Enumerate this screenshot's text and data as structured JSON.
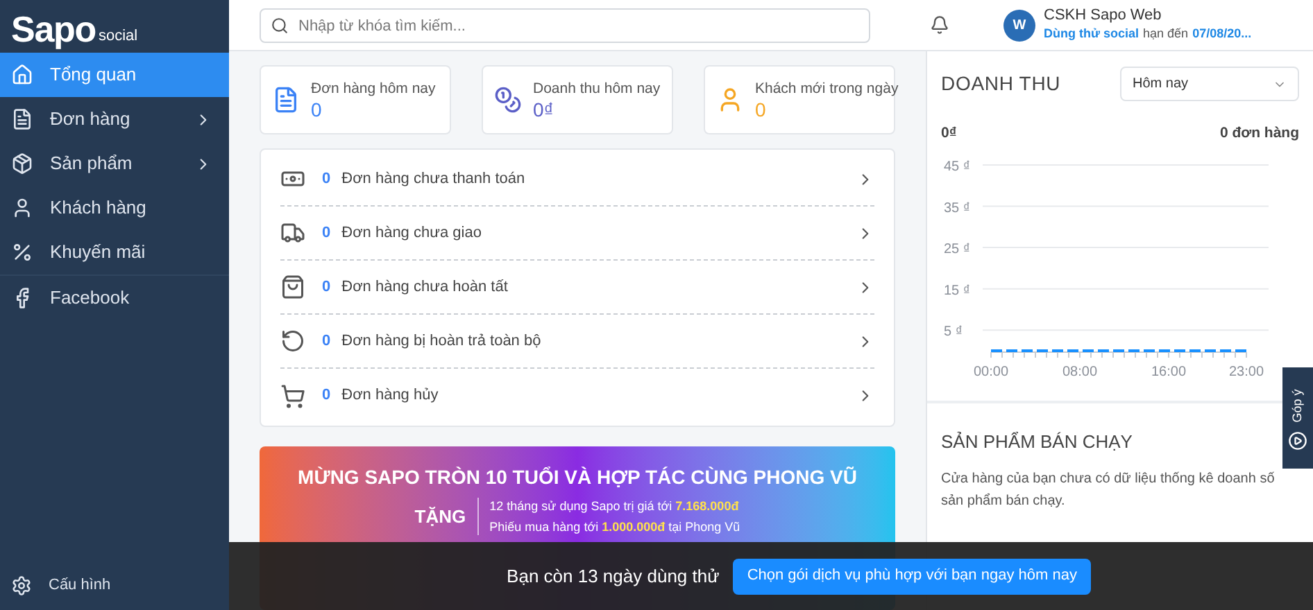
{
  "logo": {
    "name": "Sapo",
    "suffix": "social"
  },
  "sidebar": {
    "items": [
      {
        "label": "Tổng quan",
        "selected": true,
        "has_submenu": false
      },
      {
        "label": "Đơn hàng",
        "selected": false,
        "has_submenu": true
      },
      {
        "label": "Sản phẩm",
        "selected": false,
        "has_submenu": true
      },
      {
        "label": "Khách hàng",
        "selected": false,
        "has_submenu": false
      },
      {
        "label": "Khuyến mãi",
        "selected": false,
        "has_submenu": false
      },
      {
        "label": "Facebook",
        "selected": false,
        "has_submenu": false
      }
    ],
    "settings": "Cấu hình"
  },
  "header": {
    "search": {
      "placeholder": "Nhập từ khóa tìm kiếm..."
    },
    "user": {
      "avatar": "W",
      "name": "CSKH Sapo Web",
      "trial_label": "Dùng thử social",
      "trial_middle": "hạn đến",
      "trial_date": "07/08/20..."
    }
  },
  "stats": [
    {
      "label": "Đơn hàng hôm nay",
      "value": "0",
      "color": "#3b82f6"
    },
    {
      "label": "Doanh thu hôm nay",
      "value": "0₫",
      "color": "#5b5fc7"
    },
    {
      "label": "Khách mới trong ngày",
      "value": "0",
      "color": "#f5a623"
    }
  ],
  "orders": [
    {
      "count": "0",
      "label": "Đơn hàng chưa thanh toán"
    },
    {
      "count": "0",
      "label": "Đơn hàng chưa giao"
    },
    {
      "count": "0",
      "label": "Đơn hàng chưa hoàn tất"
    },
    {
      "count": "0",
      "label": "Đơn hàng bị hoàn trả toàn bộ"
    },
    {
      "count": "0",
      "label": "Đơn hàng hủy"
    }
  ],
  "banner": {
    "title": "MỪNG SAPO TRÒN 10 TUỔI VÀ HỢP TÁC CÙNG PHONG VŨ",
    "gift_label": "TẶNG",
    "lines": [
      "12 tháng sử dụng Sapo trị giá tới **7.168.000đ**",
      "Phiếu mua hàng tới **1.000.000đ** tại Phong Vũ"
    ]
  },
  "revenue": {
    "title": "DOANH THU",
    "period": "Hôm nay",
    "total": "0₫",
    "orders": "0 đơn hàng",
    "chart_data": {
      "type": "line",
      "x": [
        0,
        1,
        2,
        3,
        4,
        5,
        6,
        7,
        8,
        9,
        10,
        11,
        12,
        13,
        14,
        15,
        16,
        17,
        18,
        19,
        20,
        21,
        22,
        23
      ],
      "xlim": [
        0,
        23
      ],
      "ylim": [
        0,
        45
      ],
      "series": [
        {
          "color": "#1890ff",
          "line_style": "dashed",
          "values": [
            0,
            0,
            0,
            0,
            0,
            0,
            0,
            0,
            0,
            0,
            0,
            0,
            0,
            0,
            0,
            0,
            0,
            0,
            0,
            0,
            0,
            0,
            0,
            0
          ]
        }
      ],
      "grid": true,
      "xticks": [
        {
          "value": 0,
          "label": "00:00"
        },
        {
          "value": 8,
          "label": "08:00"
        },
        {
          "value": 16,
          "label": "16:00"
        },
        {
          "value": 23,
          "label": "23:00"
        }
      ],
      "yticks": [
        {
          "value": 5,
          "label": "5 ₫"
        },
        {
          "value": 15,
          "label": "15 ₫"
        },
        {
          "value": 25,
          "label": "25 ₫"
        },
        {
          "value": 35,
          "label": "35 ₫"
        },
        {
          "value": 45,
          "label": "45 ₫"
        }
      ]
    }
  },
  "best_sellers": {
    "title": "SẢN PHẨM BÁN CHẠY",
    "message": "Cửa hàng của bạn chưa có dữ liệu thống kê doanh số sản phẩm bán chạy."
  },
  "feedback_tab": "Góp ý",
  "trial_bar": {
    "message": "Bạn còn 13 ngày dùng thử",
    "button": "Chọn gói dịch vụ phù hợp với bạn ngay hôm nay"
  }
}
